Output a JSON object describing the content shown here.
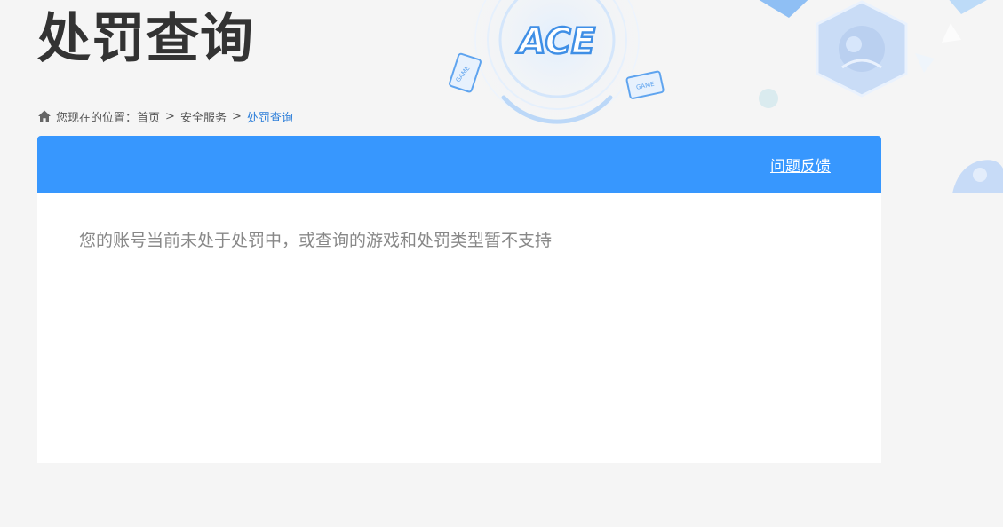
{
  "page": {
    "title": "处罚查询"
  },
  "breadcrumb": {
    "prefix": "您现在的位置：",
    "items": [
      {
        "label": "首页"
      },
      {
        "label": "安全服务"
      }
    ],
    "separator": ">",
    "current": "处罚查询"
  },
  "panel": {
    "feedback_label": "问题反馈",
    "message": "您的账号当前未处于处罚中，或查询的游戏和处罚类型暂不支持"
  },
  "hero_art": {
    "logo_text": "ACE",
    "badge_text": "GAME"
  },
  "colors": {
    "header_blue": "#3797fe",
    "link_blue": "#2e7fd9",
    "title_text": "#333333",
    "message_text": "#888888",
    "page_background": "#f5f5f5"
  }
}
